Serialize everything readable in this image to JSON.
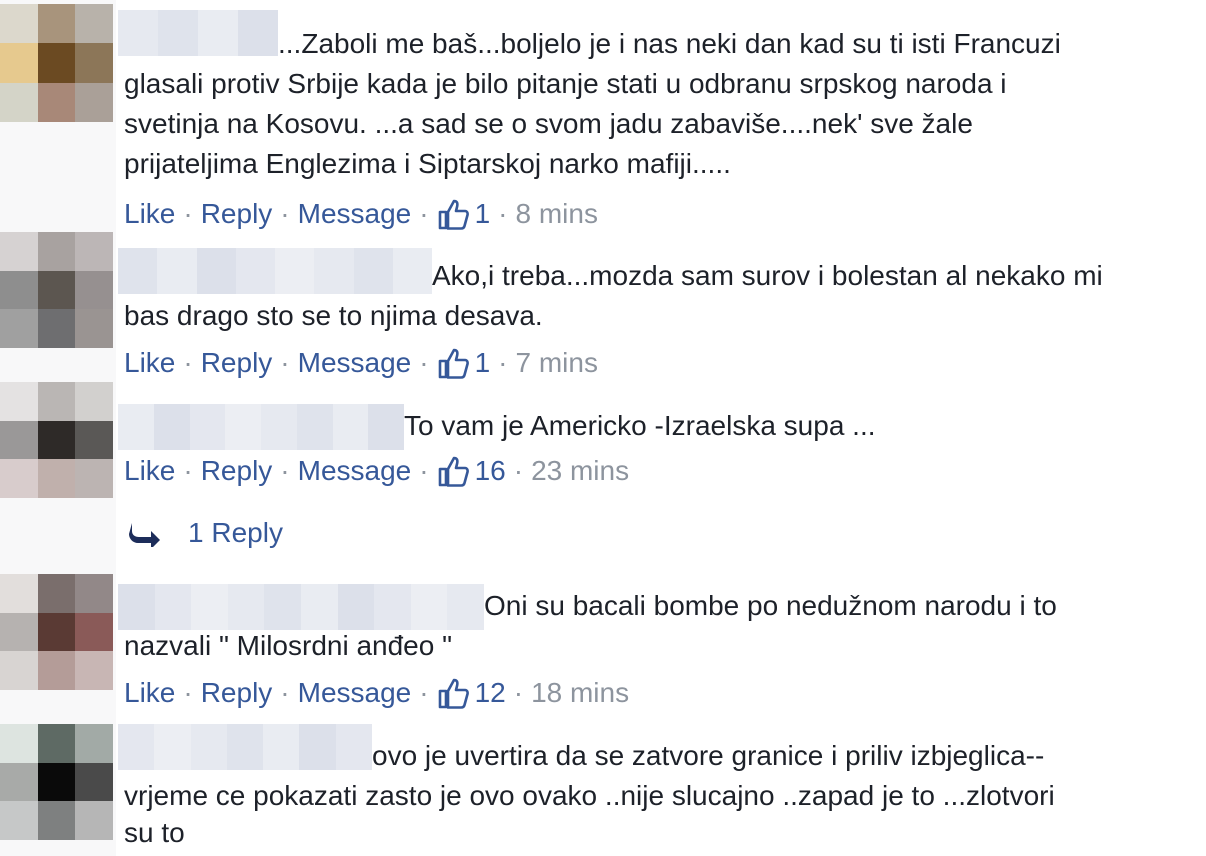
{
  "comments": [
    {
      "text_lines": [
        "...Zaboli me baš...boljelo je i nas neki dan kad su ti isti Francuzi",
        "glasali protiv Srbije kada je bilo pitanje stati u odbranu srpskog naroda i",
        "svetinja na Kosovu. ...a sad se o svom jadu zabaviše....nek' sve žale",
        "prijateljima Englezima i Siptarskoj narko mafiji....."
      ],
      "like_label": "Like",
      "reply_label": "Reply",
      "message_label": "Message",
      "likes": "1",
      "time": "8 mins",
      "avatar_colors": [
        "#dcd8cc",
        "#a8947c",
        "#b8b2aa",
        "#e6c98e",
        "#6b4a22",
        "#8c7658",
        "#d4d4c8",
        "#a88878",
        "#aaa098"
      ]
    },
    {
      "text_lines": [
        "Ako,i treba...mozda sam surov i bolestan al nekako mi",
        "bas drago sto se to njima desava."
      ],
      "like_label": "Like",
      "reply_label": "Reply",
      "message_label": "Message",
      "likes": "1",
      "time": "7 mins",
      "avatar_colors": [
        "#d6d2d2",
        "#a8a2a0",
        "#bcb6b6",
        "#8e8e8e",
        "#5c5650",
        "#969090",
        "#a0a0a0",
        "#6e6e70",
        "#9a9492"
      ]
    },
    {
      "text_lines": [
        "To vam je Americko -Izraelska supa ..."
      ],
      "like_label": "Like",
      "reply_label": "Reply",
      "message_label": "Message",
      "likes": "16",
      "time": "23 mins",
      "avatar_colors": [
        "#e4e2e2",
        "#bab6b4",
        "#d2d0ce",
        "#9a9898",
        "#2e2a28",
        "#5a5856",
        "#d8cccc",
        "#c0b0ac",
        "#bcb4b2"
      ]
    },
    {
      "text_lines": [
        "Oni su bacali bombe po nedužnom narodu i to",
        "nazvali \" Milosrdni anđeo \""
      ],
      "like_label": "Like",
      "reply_label": "Reply",
      "message_label": "Message",
      "likes": "12",
      "time": "18 mins",
      "avatar_colors": [
        "#e2dedc",
        "#7a6e6c",
        "#928888",
        "#b6b2b0",
        "#5a3a34",
        "#8a5a58",
        "#d8d4d2",
        "#b49c98",
        "#c8b6b4"
      ]
    },
    {
      "text_lines": [
        "ovo je uvertira da se zatvore granice i priliv izbjeglica--",
        "vrjeme ce pokazati zasto je ovo ovako ..nije slucajno ..zapad je to ...zlotvori",
        "su to"
      ],
      "avatar_colors": [
        "#dde4e0",
        "#5e6a64",
        "#a2aaa6",
        "#a8aaa8",
        "#0a0a0a",
        "#4a4a4a",
        "#c6c8c8",
        "#7e8080",
        "#b6b6b6"
      ]
    }
  ],
  "replies_link": "1 Reply",
  "colors": {
    "link": "#365899",
    "meta": "#8d949e",
    "text": "#1d2129",
    "name_blur": "#d9dde8"
  }
}
